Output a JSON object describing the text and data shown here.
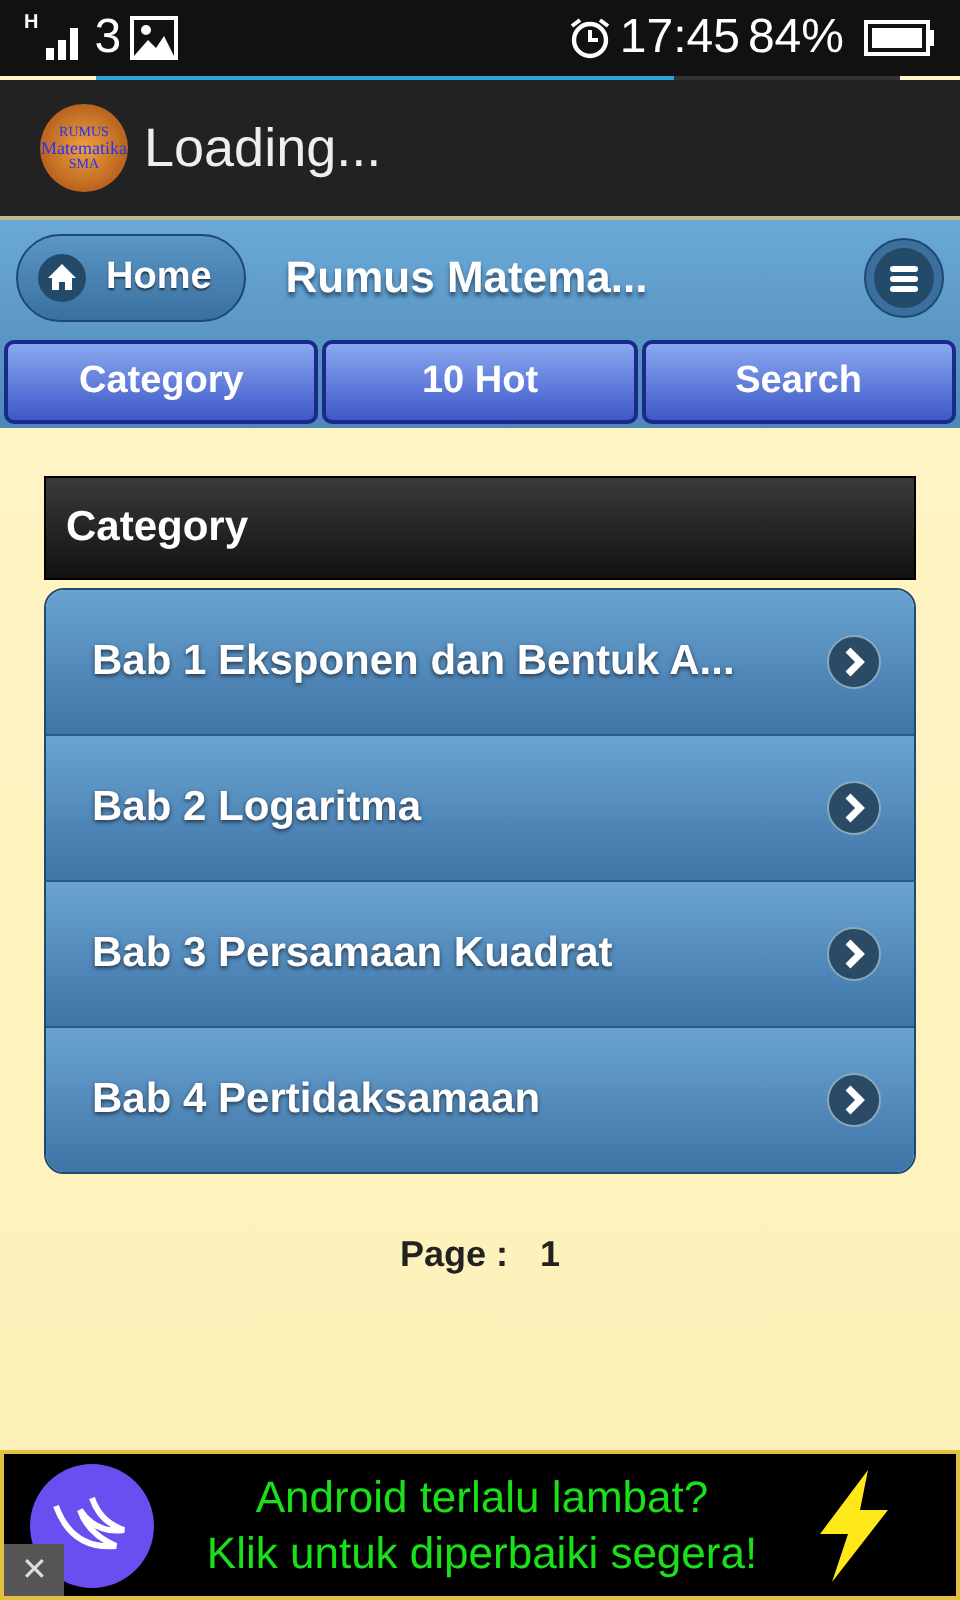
{
  "status_bar": {
    "network": "H",
    "carrier": "3",
    "time": "17:45",
    "battery": "84%"
  },
  "action_bar": {
    "logo_lines": [
      "RUMUS",
      "Matematika",
      "SMA"
    ],
    "title": "Loading...",
    "progress": {
      "level": 0.72
    }
  },
  "header": {
    "home_button": "Home",
    "title": "Rumus Matema...",
    "tabs": [
      {
        "label": "Category",
        "selected": false
      },
      {
        "label": "10 Hot",
        "selected": false
      },
      {
        "label": "Search",
        "selected": false
      }
    ]
  },
  "section_title": "Category",
  "list": [
    {
      "label": "Bab 1 Eksponen dan Bentuk A..."
    },
    {
      "label": "Bab 2 Logaritma"
    },
    {
      "label": "Bab 3 Persamaan Kuadrat"
    },
    {
      "label": "Bab 4 Pertidaksamaan"
    }
  ],
  "pager": {
    "label": "Page :",
    "value": "1"
  },
  "ad": {
    "lines": [
      "Android terlalu lambat?",
      "Klik untuk diperbaiki segera!"
    ],
    "close": "✕"
  }
}
